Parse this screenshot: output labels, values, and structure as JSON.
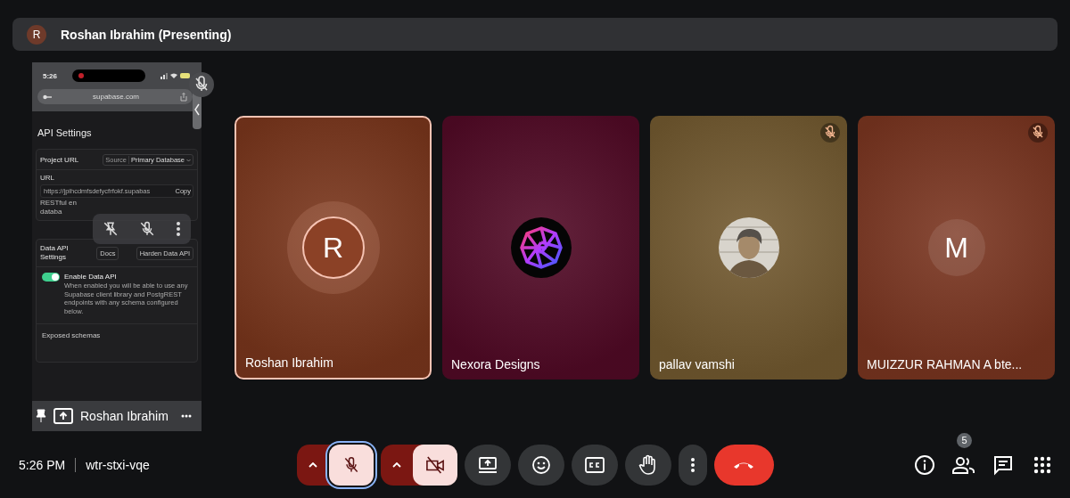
{
  "presenter_bar": {
    "initial": "R",
    "title": "Roshan Ibrahim (Presenting)"
  },
  "screen_share": {
    "muted": true,
    "phone_time": "5:26",
    "address": "supabase.com",
    "heading": "API Settings",
    "project_card": {
      "title": "Project URL",
      "source_label": "Source",
      "source_value": "Primary Database",
      "url_label": "URL",
      "url_value": "https://jpihcdmfsdefycfrfokf.supabas",
      "copy_label": "Copy",
      "note_start": "RESTful en",
      "note_cut": "databa"
    },
    "data_api_card": {
      "title": "Data API Settings",
      "buttons": [
        "Docs",
        "Harden Data API"
      ],
      "toggle_on": true,
      "toggle_label": "Enable Data API",
      "description": "When enabled you will be able to use any Supabase client library and PostgREST endpoints with any schema configured below.",
      "schemas_label": "Exposed schemas"
    },
    "presenter_name": "Roshan Ibrahim"
  },
  "participants": [
    {
      "name": "Roshan Ibrahim",
      "kind": "initial",
      "initial": "R",
      "speaking": true,
      "muted": false,
      "color": "#7a361c"
    },
    {
      "name": "Nexora Designs",
      "kind": "logo",
      "speaking": false,
      "muted": false,
      "color": "#520a26"
    },
    {
      "name": "pallav vamshi",
      "kind": "picture",
      "speaking": false,
      "muted": true,
      "color": "#735a30"
    },
    {
      "name": "MUIZZUR RAHMAN A bte...",
      "kind": "initial",
      "initial": "M",
      "speaking": false,
      "muted": true,
      "color": "#7a3520"
    }
  ],
  "meeting": {
    "time": "5:26 PM",
    "code": "wtr-stxi-vqe"
  },
  "controls": [
    {
      "kind": "mic",
      "on": false,
      "focused": true
    },
    {
      "kind": "camera",
      "on": false,
      "focused": false
    },
    {
      "kind": "present"
    },
    {
      "kind": "reactions"
    },
    {
      "kind": "captions"
    },
    {
      "kind": "raise-hand"
    },
    {
      "kind": "more"
    },
    {
      "kind": "leave"
    }
  ],
  "side_controls": [
    {
      "kind": "info"
    },
    {
      "kind": "people",
      "badge": "5"
    },
    {
      "kind": "chat"
    },
    {
      "kind": "activities"
    }
  ]
}
